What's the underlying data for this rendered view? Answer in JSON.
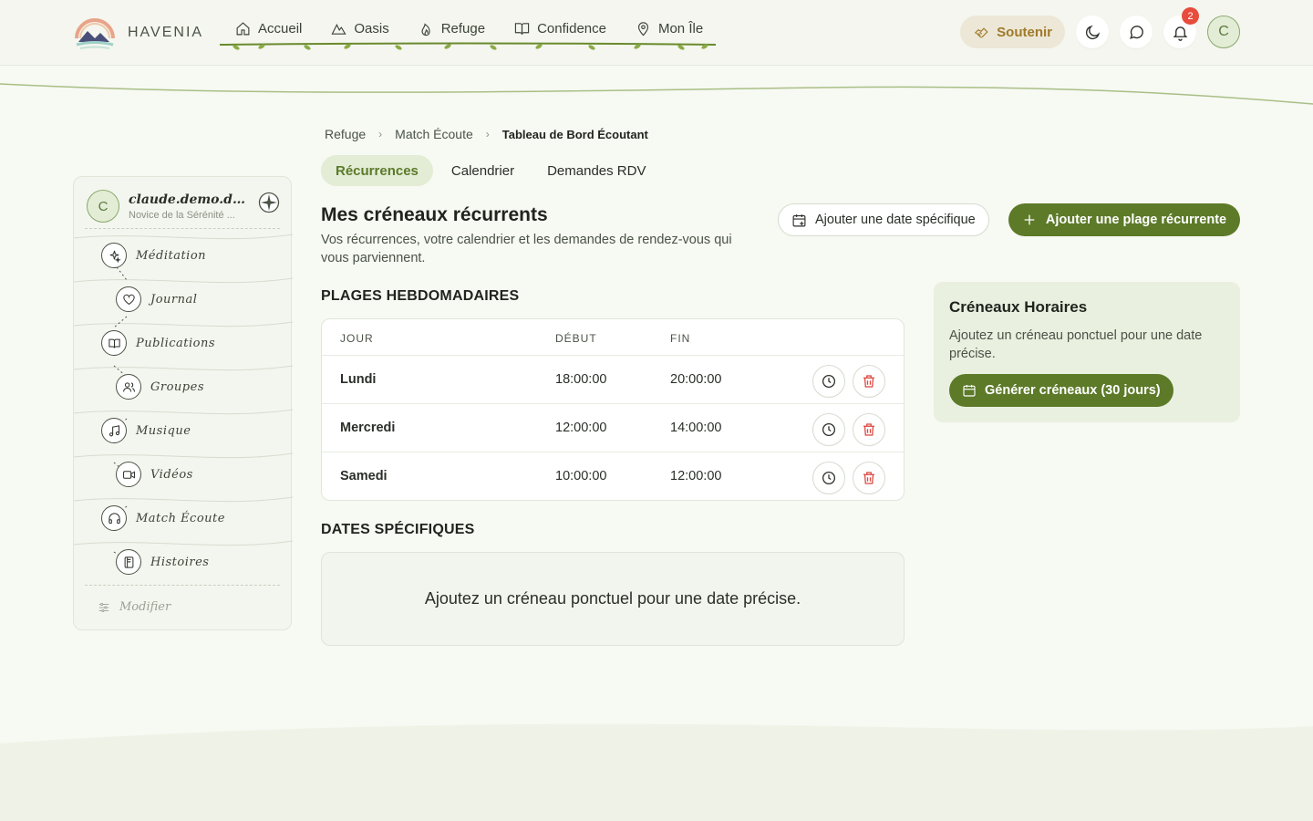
{
  "brand": {
    "name": "HAVENIA"
  },
  "nav": {
    "items": [
      {
        "label": "Accueil",
        "icon": "home-icon"
      },
      {
        "label": "Oasis",
        "icon": "mountain-icon"
      },
      {
        "label": "Refuge",
        "icon": "flame-icon"
      },
      {
        "label": "Confidence",
        "icon": "book-icon"
      },
      {
        "label": "Mon Île",
        "icon": "map-pin-icon"
      }
    ]
  },
  "header": {
    "support_label": "Soutenir",
    "notification_count": "2",
    "user_initial": "C"
  },
  "sidebar": {
    "user_initial": "C",
    "user_name": "claude.demo.des...",
    "user_level": "Novice de la Sérénité ...",
    "items": [
      {
        "label": "Méditation",
        "icon": "sparkles-icon"
      },
      {
        "label": "Journal",
        "icon": "heart-icon"
      },
      {
        "label": "Publications",
        "icon": "open-book-icon"
      },
      {
        "label": "Groupes",
        "icon": "users-icon"
      },
      {
        "label": "Musique",
        "icon": "music-icon"
      },
      {
        "label": "Vidéos",
        "icon": "video-icon"
      },
      {
        "label": "Match Écoute",
        "icon": "headphones-icon"
      },
      {
        "label": "Histoires",
        "icon": "notebook-icon"
      }
    ],
    "modify_label": "Modifier"
  },
  "breadcrumb": [
    "Refuge",
    "Match Écoute",
    "Tableau de Bord Écoutant"
  ],
  "tabs": [
    {
      "label": "Récurrences",
      "active": true
    },
    {
      "label": "Calendrier",
      "active": false
    },
    {
      "label": "Demandes RDV",
      "active": false
    }
  ],
  "main": {
    "title": "Mes créneaux récurrents",
    "description": "Vos récurrences, votre calendrier et les demandes de rendez-vous qui vous parviennent.",
    "add_specific_date_label": "Ajouter une date spécifique",
    "add_recurring_label": "Ajouter une plage récurrente",
    "weekly_title": "PLAGES HEBDOMADAIRES",
    "columns": [
      "JOUR",
      "DÉBUT",
      "FIN"
    ],
    "rows": [
      {
        "day": "Lundi",
        "start": "18:00:00",
        "end": "20:00:00"
      },
      {
        "day": "Mercredi",
        "start": "12:00:00",
        "end": "14:00:00"
      },
      {
        "day": "Samedi",
        "start": "10:00:00",
        "end": "12:00:00"
      }
    ],
    "specific_title": "DATES SPÉCIFIQUES",
    "specific_empty": "Ajoutez un créneau ponctuel pour une date précise."
  },
  "slots_card": {
    "title": "Créneaux Horaires",
    "description": "Ajoutez un créneau ponctuel pour une date précise.",
    "button_label": "Générer créneaux (30 jours)"
  },
  "colors": {
    "accent": "#5c7a28",
    "tab_active_bg": "#e3ecd5",
    "danger": "#d9463d",
    "support": "#a07a2a",
    "badge": "#e74c3c"
  }
}
